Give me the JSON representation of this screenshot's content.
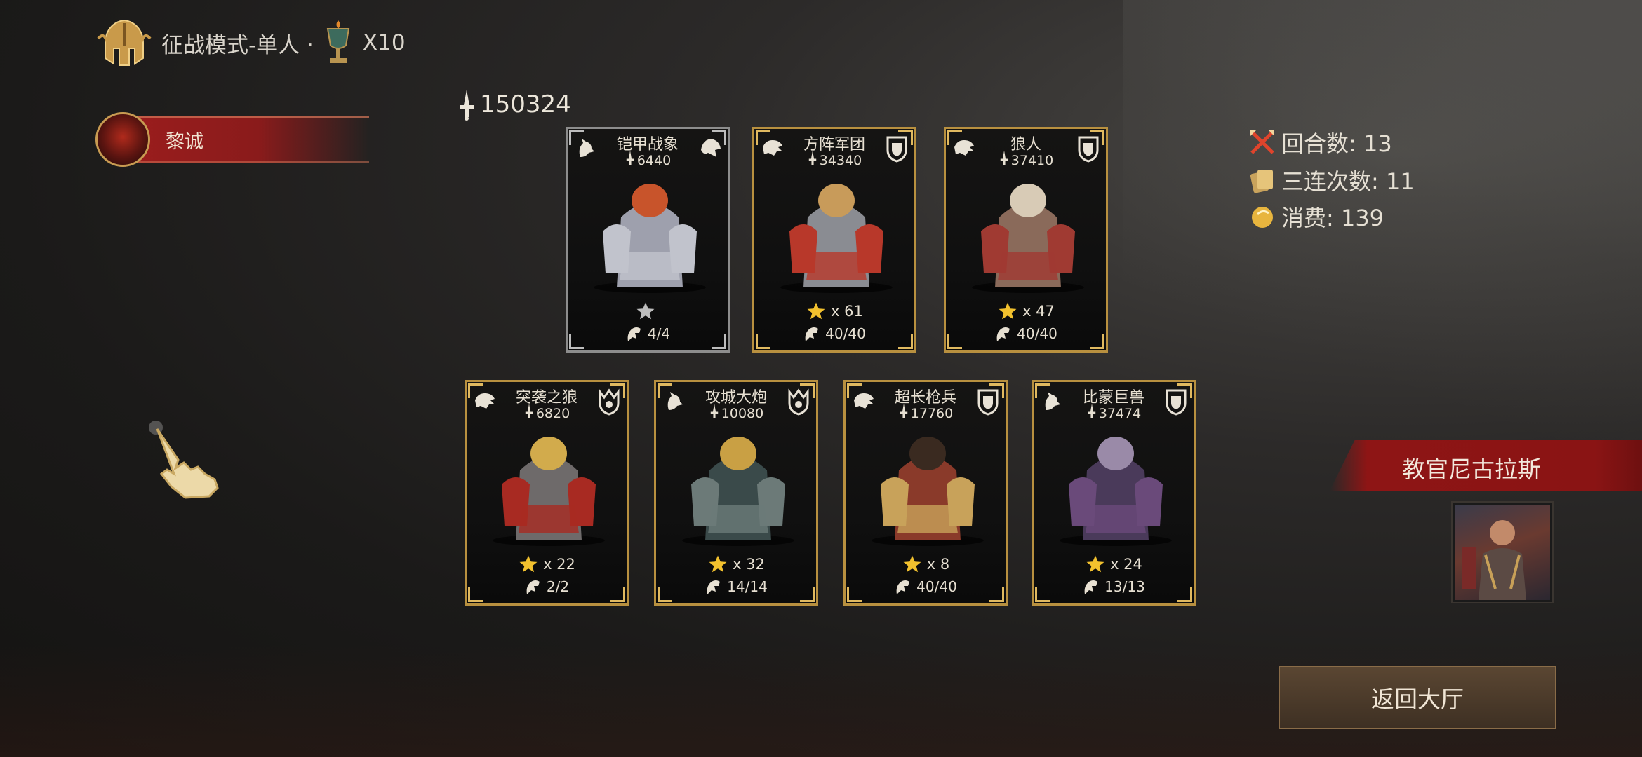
{
  "header": {
    "mode_title": "征战模式-单人 ·",
    "multiplier": "X10"
  },
  "player": {
    "name": "黎诚"
  },
  "power_total": "150324",
  "cards": [
    {
      "name": "铠甲战象",
      "power": "6440",
      "stars": "",
      "troops": "4/4",
      "frame": "gray",
      "race": "wolf-emblem",
      "class": "beast-head"
    },
    {
      "name": "方阵军团",
      "power": "34340",
      "stars": "x 61",
      "troops": "40/40",
      "frame": "gold",
      "race": "lion-emblem",
      "class": "shield"
    },
    {
      "name": "狼人",
      "power": "37410",
      "stars": "x 47",
      "troops": "40/40",
      "frame": "gold",
      "race": "lion-emblem",
      "class": "shield"
    },
    {
      "name": "突袭之狼",
      "power": "6820",
      "stars": "x 22",
      "troops": "2/2",
      "frame": "gold",
      "race": "lion-emblem",
      "class": "crown-shield"
    },
    {
      "name": "攻城大炮",
      "power": "10080",
      "stars": "x 32",
      "troops": "14/14",
      "frame": "gold",
      "race": "wolf-emblem",
      "class": "crown-shield"
    },
    {
      "name": "超长枪兵",
      "power": "17760",
      "stars": "x 8",
      "troops": "40/40",
      "frame": "gold",
      "race": "lion-emblem",
      "class": "shield"
    },
    {
      "name": "比蒙巨兽",
      "power": "37474",
      "stars": "x 24",
      "troops": "13/13",
      "frame": "gold",
      "race": "wolf-emblem",
      "class": "shield"
    }
  ],
  "stats": {
    "rounds": "回合数: 13",
    "triples": "三连次数: 11",
    "cost": "消费: 139"
  },
  "instructor": {
    "name": "教官尼古拉斯"
  },
  "buttons": {
    "return": "返回大厅"
  },
  "colors": {
    "gold": "#b8903f",
    "red_banner": "#8e1515",
    "text": "#e7e0d2"
  }
}
